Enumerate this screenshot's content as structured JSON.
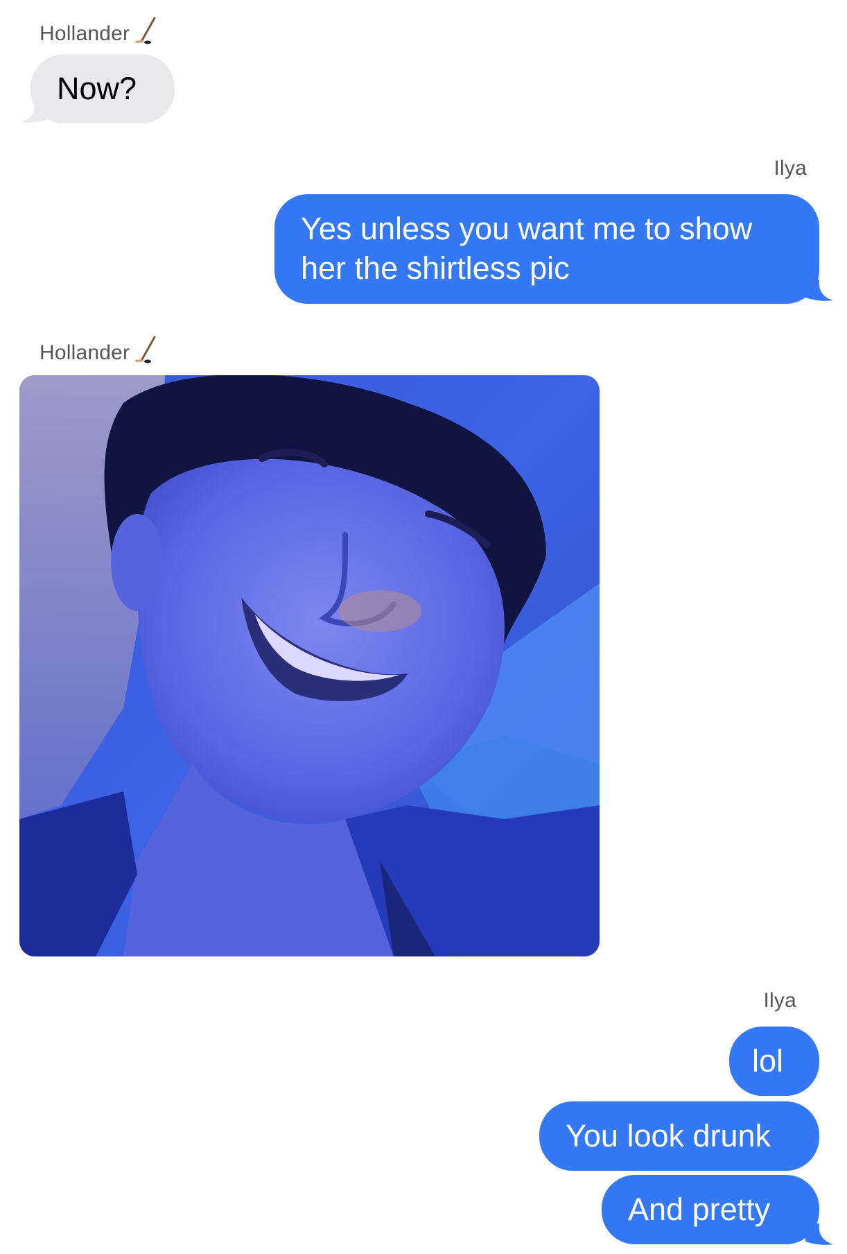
{
  "conversation": {
    "sender_label_1": "Hollander",
    "message_1": "Now?",
    "sender_label_2": "Ilya",
    "message_2_line_1": "Yes unless you want me to show",
    "message_2_line_2": "her the shirtless pic",
    "sender_label_3": "Hollander",
    "sender_label_4": "Ilya",
    "message_4": "lol",
    "message_5": "You look drunk",
    "message_6": "And pretty"
  },
  "icons": {
    "sender_emoji": "ice-hockey-stick-icon"
  },
  "colors": {
    "incoming_bubble": "#e9e9eb",
    "outgoing_bubble": "#3478f6",
    "sender_label": "#555555",
    "background": "#ffffff"
  }
}
